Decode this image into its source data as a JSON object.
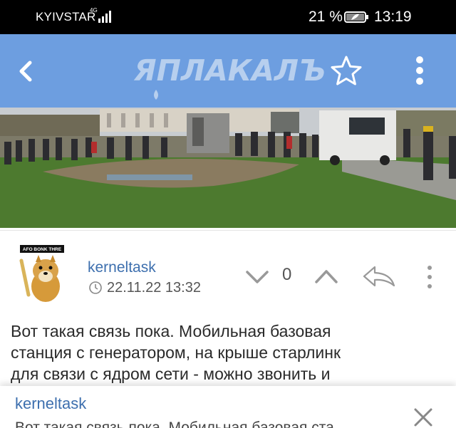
{
  "status_bar": {
    "carrier": "KYIVSTAR",
    "network": "4G",
    "battery_percent": "21 %",
    "time": "13:19"
  },
  "app_bar": {
    "logo": "ЯПЛАКАЛЪ",
    "icons": [
      "back-arrow-icon",
      "star-icon",
      "more-vertical-icon"
    ],
    "color": "#6d9ee0"
  },
  "photo": {
    "scene_colors": {
      "sky": "#c8ccd0",
      "grass": "#4d7a2f",
      "ground": "#8a7b60"
    },
    "overlay_text": "AFO BONK THR"
  },
  "post": {
    "author": "kerneltask",
    "date": "22.11.22 13:32",
    "score": "0",
    "avatar_caption": "AFO BONK THRE",
    "body_lines": [
      "Вот такая связь пока. Мобильная базовая",
      "станция с генератором, на крыше старлинк",
      "для связи с ядром сети - можно звонить и"
    ]
  },
  "quote_bar": {
    "author": "kerneltask",
    "text": "Вот такая связь пока. Мобильная базовая ста"
  },
  "colors": {
    "accent": "#3d6fae",
    "status_bg": "#000000"
  }
}
